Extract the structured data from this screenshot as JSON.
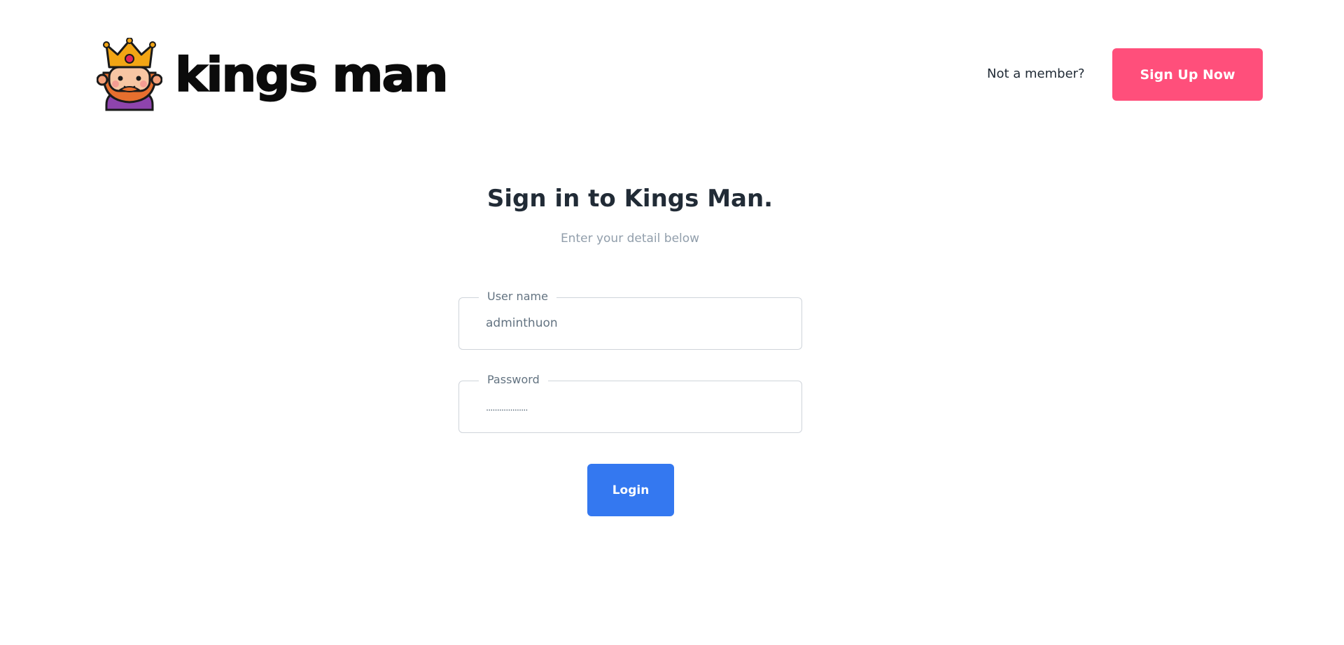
{
  "header": {
    "brand_name": "kings man",
    "logo_icon": "king-mascot-icon",
    "not_member_text": "Not a member?",
    "signup_label": "Sign Up Now"
  },
  "main": {
    "title": "Sign in to Kings Man.",
    "subtitle": "Enter your detail below",
    "username": {
      "label": "User name",
      "value": "adminthuon"
    },
    "password": {
      "label": "Password",
      "value": "..................."
    },
    "login_label": "Login"
  },
  "colors": {
    "signup_accent": "#ff4f7b",
    "login_accent": "#3478f0",
    "text_primary": "#212b36",
    "text_muted": "#919eab"
  }
}
